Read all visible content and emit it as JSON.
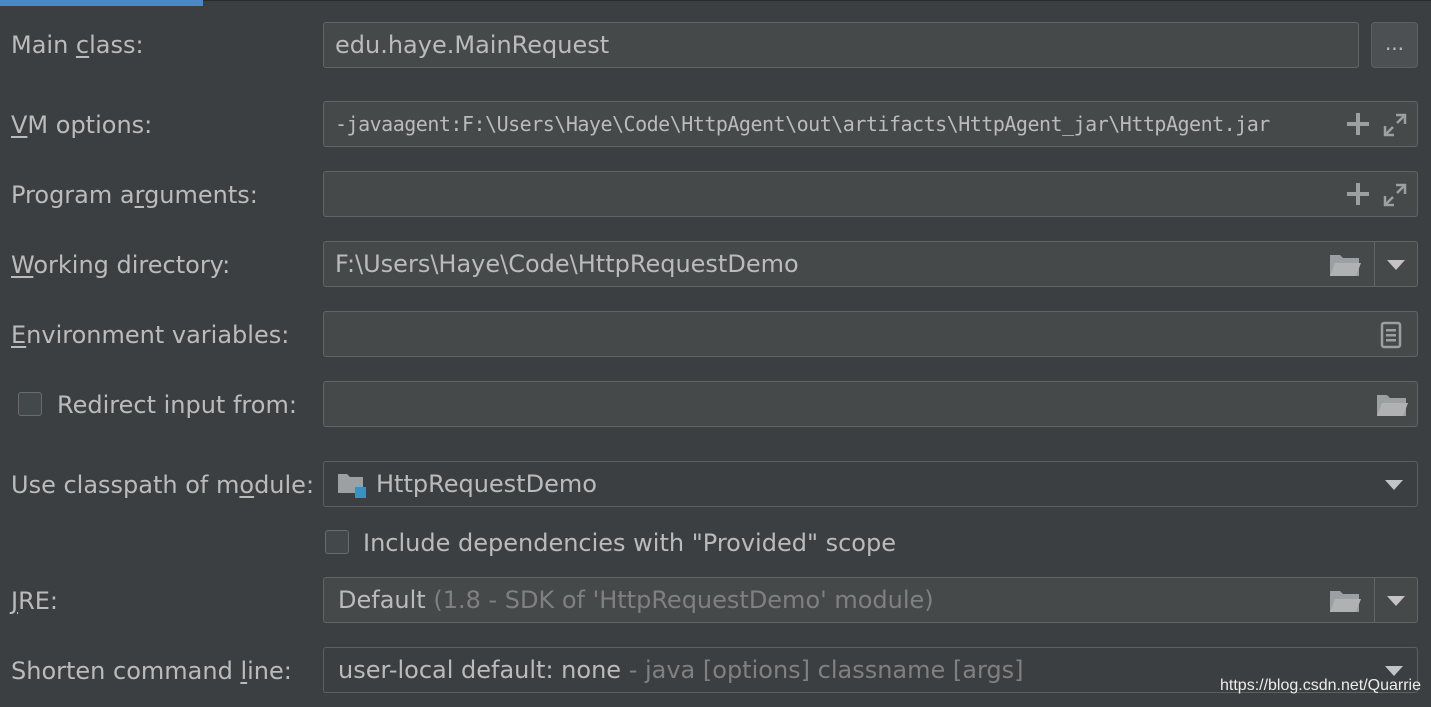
{
  "tabs": {
    "active_color": "#4a88c7"
  },
  "colors": {
    "background": "#3c3f41",
    "field": "#45494a",
    "border": "#646464",
    "text": "#bbbbbb",
    "muted": "#808080",
    "accent": "#3592c4"
  },
  "main_class": {
    "label_pre": "Main ",
    "label_key": "c",
    "label_post": "lass:",
    "value": "edu.haye.MainRequest",
    "browse_label": "..."
  },
  "vm_options": {
    "label_key": "V",
    "label_post": "M options:",
    "value": "-javaagent:F:\\Users\\Haye\\Code\\HttpAgent\\out\\artifacts\\HttpAgent_jar\\HttpAgent.jar",
    "icons": [
      "plus-icon",
      "expand-icon"
    ]
  },
  "program_arguments": {
    "label_pre": "Program a",
    "label_key": "r",
    "label_post": "guments:",
    "value": "",
    "icons": [
      "plus-icon",
      "expand-icon"
    ]
  },
  "working_directory": {
    "label_key": "W",
    "label_post": "orking directory:",
    "value": "F:\\Users\\Haye\\Code\\HttpRequestDemo",
    "icons": [
      "folder-icon",
      "chevron-down-icon"
    ]
  },
  "environment_variables": {
    "label_key": "E",
    "label_post": "nvironment variables:",
    "value": "",
    "icons": [
      "document-icon"
    ]
  },
  "redirect_input": {
    "label": "Redirect input from:",
    "checked": false,
    "value": "",
    "icons": [
      "folder-icon"
    ]
  },
  "classpath_module": {
    "label_pre": "Use classpath of m",
    "label_key": "o",
    "label_post": "dule:",
    "value": "HttpRequestDemo",
    "icons": [
      "module-folder-icon",
      "chevron-down-icon"
    ]
  },
  "include_dependencies": {
    "label": "Include dependencies with \"Provided\" scope",
    "checked": false
  },
  "jre": {
    "label_key": "J",
    "label_post": "RE:",
    "value": "Default",
    "hint": " (1.8 - SDK of 'HttpRequestDemo' module)",
    "icons": [
      "folder-icon",
      "chevron-down-icon"
    ]
  },
  "shorten_command_line": {
    "label_pre": "Shorten command ",
    "label_key": "l",
    "label_post": "ine:",
    "value": "user-local default: none",
    "hint": " - java [options] classname [args]",
    "icons": [
      "chevron-down-icon"
    ]
  },
  "watermark": "https://blog.csdn.net/Quarrie"
}
